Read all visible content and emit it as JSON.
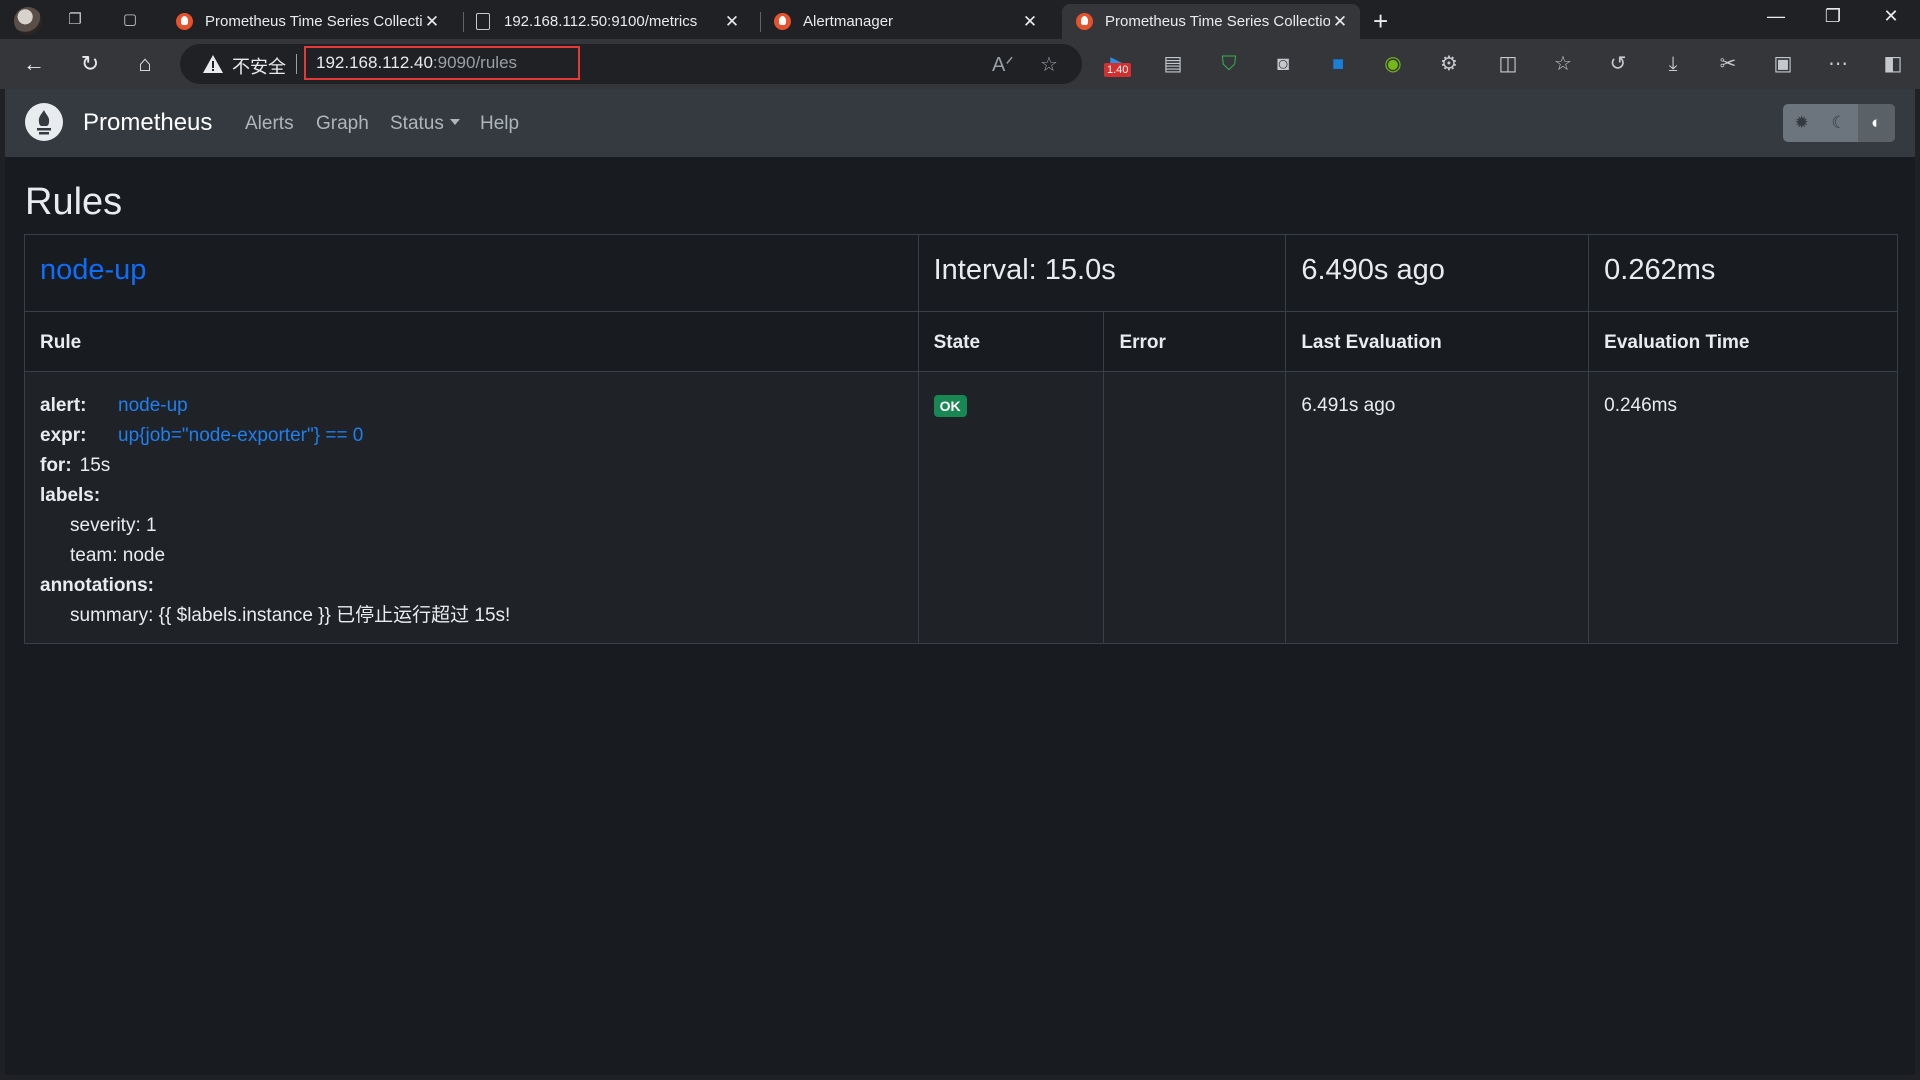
{
  "browser": {
    "tabs": [
      {
        "title": "Prometheus Time Series Collectio",
        "favicon": "prometheus-icon",
        "active": false
      },
      {
        "title": "192.168.112.50:9100/metrics",
        "favicon": "page-icon",
        "active": false
      },
      {
        "title": "Alertmanager",
        "favicon": "prometheus-icon",
        "active": false
      },
      {
        "title": "Prometheus Time Series Collectio",
        "favicon": "prometheus-icon",
        "active": true
      }
    ],
    "security_label": "不安全",
    "url_host": "192.168.112.40",
    "url_rest": ":9090/rules",
    "extension_badge": "1.40"
  },
  "app": {
    "brand": "Prometheus",
    "nav": {
      "alerts": "Alerts",
      "graph": "Graph",
      "status": "Status",
      "help": "Help"
    },
    "page_title": "Rules"
  },
  "group": {
    "name": "node-up",
    "interval": "Interval: 15.0s",
    "last_evaluation": "6.490s ago",
    "evaluation_time": "0.262ms"
  },
  "columns": {
    "rule": "Rule",
    "state": "State",
    "error": "Error",
    "last_evaluation": "Last Evaluation",
    "evaluation_time": "Evaluation Time"
  },
  "rule": {
    "alert_key": "alert:",
    "alert_value": "node-up",
    "expr_key": "expr:",
    "expr_value": "up{job=\"node-exporter\"} == 0",
    "for_key": "for:",
    "for_value": "15s",
    "labels_key": "labels:",
    "labels": [
      "severity: 1",
      "team: node"
    ],
    "annotations_key": "annotations:",
    "annotations": [
      "summary: {{ $labels.instance }} 已停止运行超过 15s!"
    ],
    "state": "OK",
    "error": "",
    "last_evaluation": "6.491s ago",
    "evaluation_time": "0.246ms"
  },
  "colors": {
    "link_blue": "#0d6efd",
    "ok_green": "#198754",
    "navbar": "#343a40",
    "background": "#181b1f"
  }
}
